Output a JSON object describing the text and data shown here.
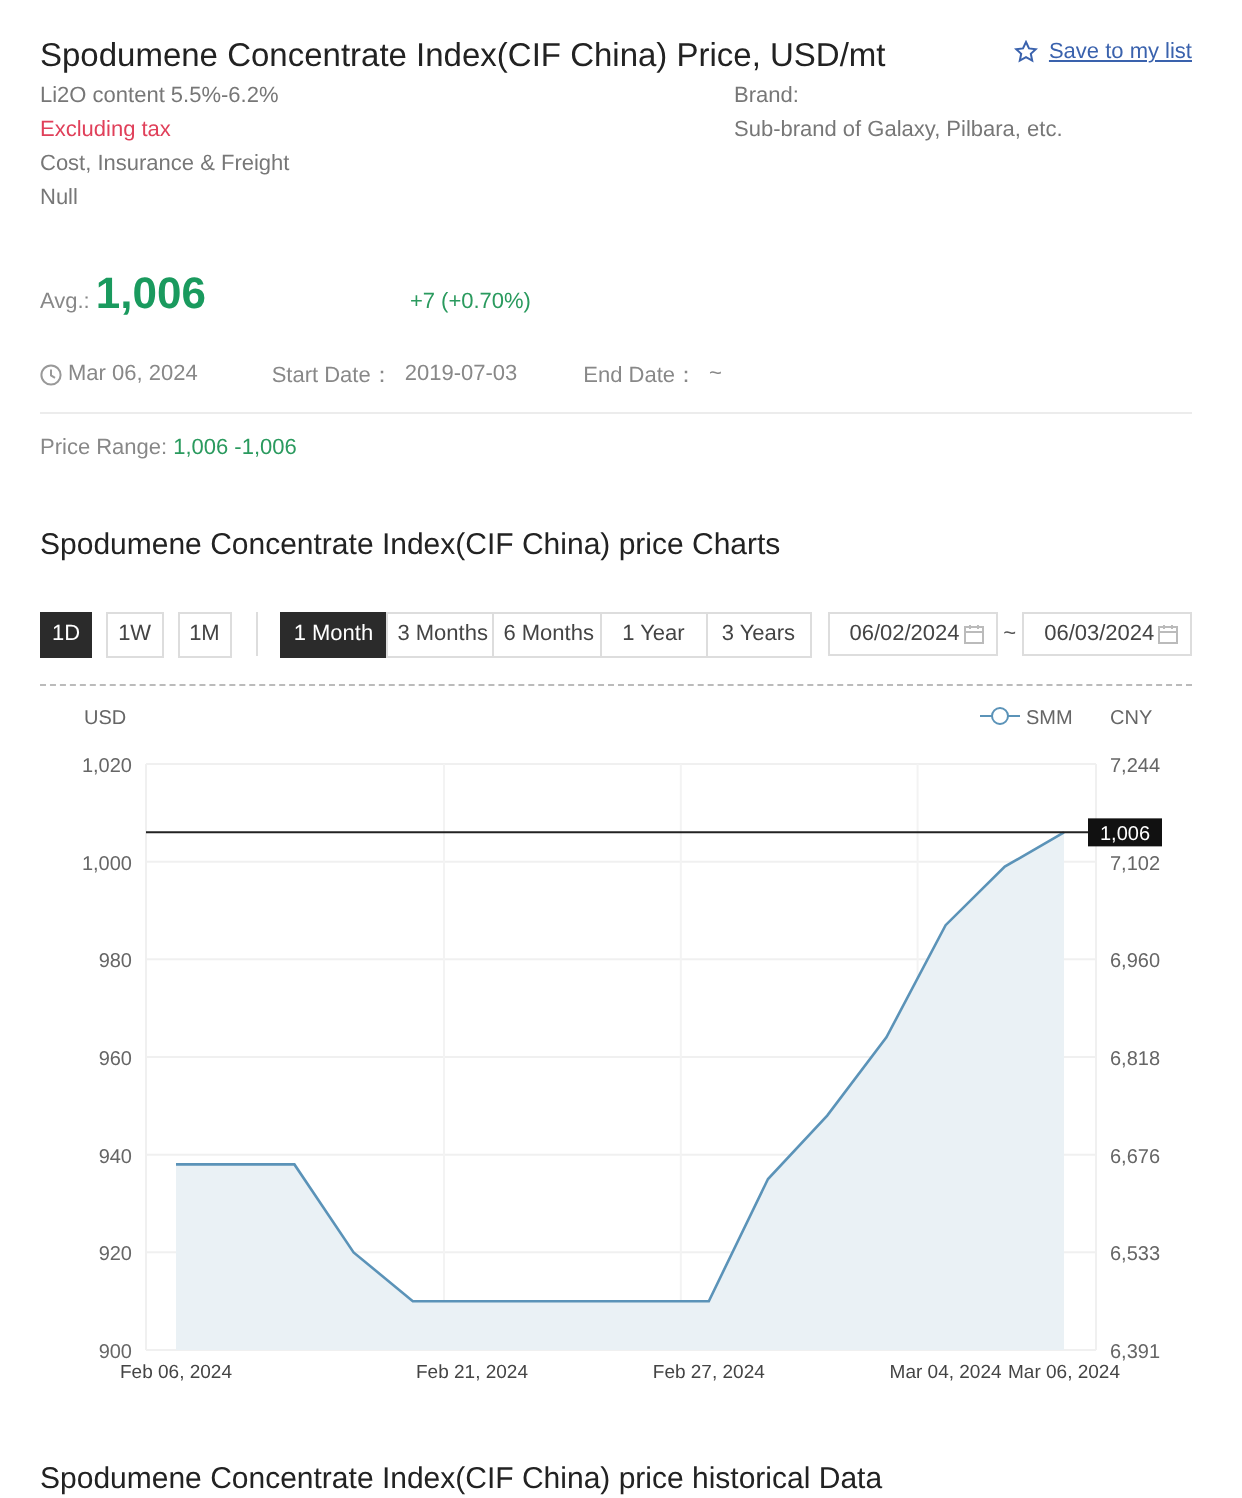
{
  "header": {
    "title": "Spodumene Concentrate Index(CIF China) Price, USD/mt",
    "save_link": "Save to my list",
    "specs": [
      {
        "text": "Li2O content 5.5%-6.2%",
        "kind": "plain"
      },
      {
        "text": "Excluding tax",
        "kind": "tax"
      },
      {
        "text": "Cost, Insurance & Freight",
        "kind": "plain"
      },
      {
        "text": "Null",
        "kind": "plain"
      }
    ],
    "brand_label": "Brand:",
    "brand_value": "Sub-brand of Galaxy, Pilbara, etc."
  },
  "price": {
    "avg_label": "Avg.:",
    "avg": "1,006",
    "change": "+7 (+0.70%)",
    "date": "Mar 06, 2024",
    "start_label": "Start Date：",
    "start": "2019-07-03",
    "end_label": "End Date：",
    "end": "~",
    "range_label": "Price Range:",
    "range": "1,006 -1,006"
  },
  "chart_section": {
    "title": "Spodumene Concentrate Index(CIF China) price Charts",
    "intervals": [
      {
        "label": "1D",
        "selected": true
      },
      {
        "label": "1W",
        "selected": false
      },
      {
        "label": "1M",
        "selected": false
      }
    ],
    "periods": [
      {
        "label": "1 Month",
        "selected": true
      },
      {
        "label": "3 Months",
        "selected": false
      },
      {
        "label": "6 Months",
        "selected": false
      },
      {
        "label": "1 Year",
        "selected": false
      },
      {
        "label": "3 Years",
        "selected": false
      }
    ],
    "date_from": "06/02/2024",
    "range_sep": "~",
    "date_to": "06/03/2024",
    "right_axis_label": "CNY",
    "right_ticks": [
      "7,244",
      "7,102",
      "6,960",
      "6,818",
      "6,676",
      "6,533",
      "6,391"
    ],
    "chart_data": {
      "type": "area",
      "ylabel": "USD",
      "categories": [
        "Feb 06, 2024",
        null,
        null,
        null,
        null,
        "Feb 21, 2024",
        null,
        null,
        null,
        "Feb 27, 2024",
        null,
        null,
        null,
        "Mar 04, 2024",
        null,
        "Mar 06, 2024"
      ],
      "series": [
        {
          "name": "SMM",
          "color": "#5b93b8",
          "values": [
            938,
            938,
            938,
            920,
            910,
            910,
            910,
            910,
            910,
            910,
            935,
            948,
            964,
            987,
            999,
            1006
          ]
        }
      ],
      "ylim": [
        900,
        1020
      ],
      "yticks": [
        {
          "value": 1020,
          "label": "1,020"
        },
        {
          "value": 1000,
          "label": "1,000"
        },
        980,
        960,
        940,
        920,
        900
      ],
      "grid": true,
      "ref_lines": [
        {
          "axis": "y",
          "value": 1006,
          "label": "1,006"
        }
      ]
    }
  },
  "history_title": "Spodumene Concentrate Index(CIF China) price historical Data"
}
